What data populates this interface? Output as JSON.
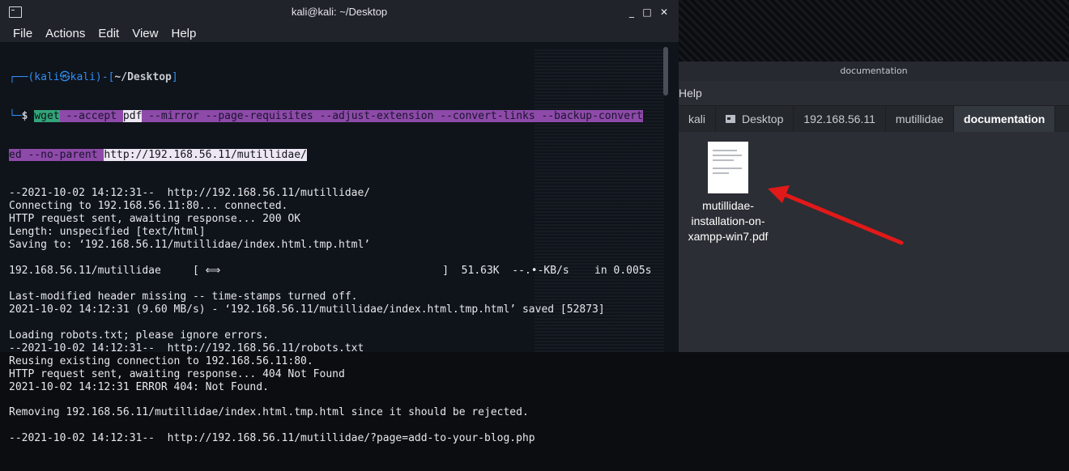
{
  "terminal": {
    "title": "kali@kali: ~/Desktop",
    "menu": [
      "File",
      "Actions",
      "Edit",
      "View",
      "Help"
    ],
    "prompt_user": "(kali㉿kali)",
    "prompt_dir": "~/Desktop",
    "command": {
      "bin": "wget",
      "flags": [
        "--accept",
        "pdf",
        "--mirror",
        "--page-requisites",
        "--adjust-extension",
        "--convert-links",
        "--backup-convert"
      ],
      "flags2": [
        "ed",
        "--no-parent",
        "http://192.168.56.11/mutillidae/"
      ]
    },
    "lines": [
      "--2021-10-02 14:12:31--  http://192.168.56.11/mutillidae/",
      "Connecting to 192.168.56.11:80... connected.",
      "HTTP request sent, awaiting response... 200 OK",
      "Length: unspecified [text/html]",
      "Saving to: ‘192.168.56.11/mutillidae/index.html.tmp.html’",
      "",
      "192.168.56.11/mutillidae     [ ⟺                                   ]  51.63K  --.•-KB/s    in 0.005s",
      "",
      "Last-modified header missing -- time-stamps turned off.",
      "2021-10-02 14:12:31 (9.60 MB/s) - ‘192.168.56.11/mutillidae/index.html.tmp.html’ saved [52873]",
      "",
      "Loading robots.txt; please ignore errors.",
      "--2021-10-02 14:12:31--  http://192.168.56.11/robots.txt",
      "Reusing existing connection to 192.168.56.11:80.",
      "HTTP request sent, awaiting response... 404 Not Found",
      "2021-10-02 14:12:31 ERROR 404: Not Found.",
      "",
      "Removing 192.168.56.11/mutillidae/index.html.tmp.html since it should be rejected.",
      "",
      "--2021-10-02 14:12:31--  http://192.168.56.11/mutillidae/?page=add-to-your-blog.php"
    ]
  },
  "file_manager": {
    "title": "documentation",
    "menu_visible": "Help",
    "breadcrumbs": [
      "kali",
      "Desktop",
      "192.168.56.11",
      "mutillidae",
      "documentation"
    ],
    "file": {
      "name": "mutillidae-installation-on-xampp-win7.pdf",
      "name_lines": [
        "mutillidae-",
        "installation-on-",
        "xampp-win7.pdf"
      ]
    }
  },
  "colors": {
    "highlight_purple": "#8d4aa8",
    "highlight_green": "#33a579",
    "prompt_blue": "#2f8df1",
    "arrow_red": "#e11919"
  }
}
